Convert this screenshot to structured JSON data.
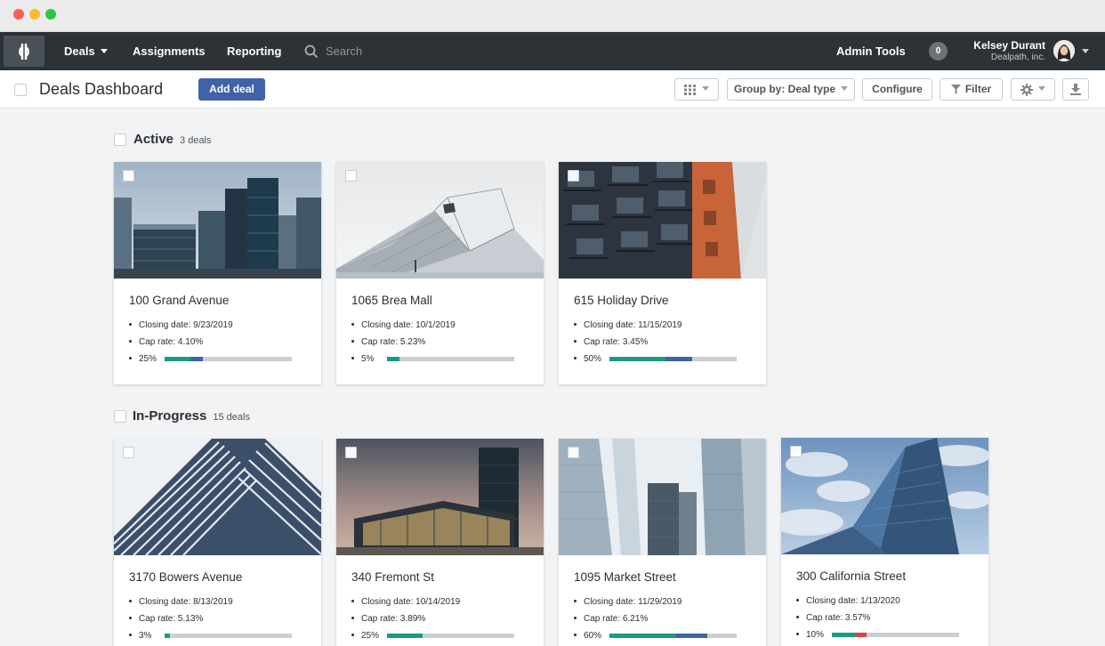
{
  "nav": {
    "deals": "Deals",
    "assignments": "Assignments",
    "reporting": "Reporting",
    "search_placeholder": "Search",
    "admin_tools": "Admin Tools",
    "notifications": "0",
    "user_name": "Kelsey Durant",
    "user_org": "Dealpath, inc."
  },
  "toolbar": {
    "title": "Deals Dashboard",
    "add_deal": "Add deal",
    "group_by": "Group by: Deal type",
    "configure": "Configure",
    "filter": "Filter"
  },
  "groups": [
    {
      "title": "Active",
      "count": "3 deals",
      "cards": [
        {
          "title": "100 Grand Avenue",
          "closing": "Closing date:  9/23/2019",
          "cap": "Cap rate:  4.10%",
          "progress": "25%",
          "progress_value": 0.3,
          "colors": [
            "#1a9b7e",
            "#3f62a8"
          ]
        },
        {
          "title": "1065 Brea Mall",
          "closing": "Closing date:  10/1/2019",
          "cap": "Cap rate:  5.23%",
          "progress": "5%",
          "progress_value": 0.1,
          "colors": [
            "#1a9b7e"
          ]
        },
        {
          "title": "615 Holiday Drive",
          "closing": "Closing date:  11/15/2019",
          "cap": "Cap rate:  3.45%",
          "progress": "50%",
          "progress_value": 0.65,
          "colors": [
            "#1a9b7e",
            "#3f62a8"
          ]
        }
      ]
    },
    {
      "title": "In-Progress",
      "count": "15 deals",
      "cards": [
        {
          "title": "3170 Bowers Avenue",
          "closing": "Closing date:  8/13/2019",
          "cap": "Cap rate:  5.13%",
          "progress": "3%",
          "progress_value": 0.04,
          "colors": [
            "#1a9b7e"
          ]
        },
        {
          "title": "340 Fremont St",
          "closing": "Closing date:  10/14/2019",
          "cap": "Cap rate:  3.89%",
          "progress": "25%",
          "progress_value": 0.28,
          "colors": [
            "#1a9b7e"
          ]
        },
        {
          "title": "1095 Market Street",
          "closing": "Closing date:  11/29/2019",
          "cap": "Cap rate:  6.21%",
          "progress": "60%",
          "progress_value": 0.77,
          "colors": [
            "#1a9b7e",
            "#3f62a8"
          ]
        },
        {
          "title": "300 California Street",
          "closing": "Closing date:  1/13/2020",
          "cap": "Cap rate:  3.57%",
          "progress": "10%",
          "progress_value": 0.27,
          "colors": [
            "#1a9b7e",
            "#d9443f"
          ]
        }
      ]
    }
  ]
}
